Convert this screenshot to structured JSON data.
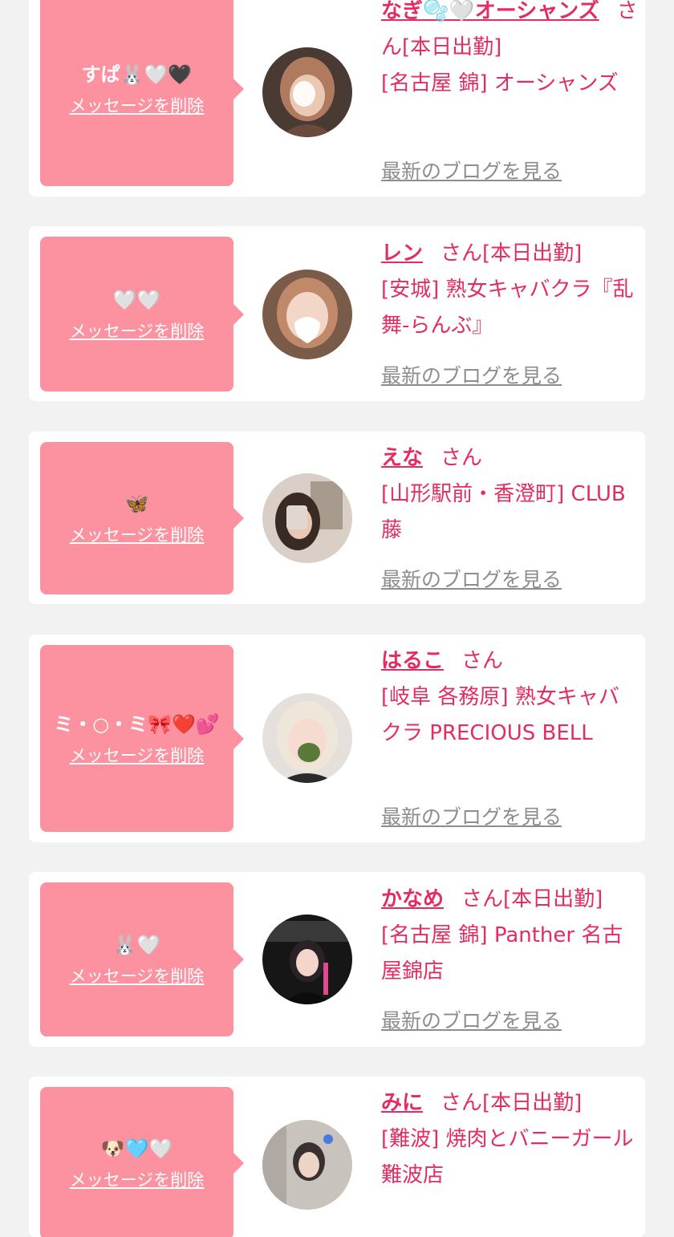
{
  "delete_label": "メッセージを削除",
  "blog_label": "最新のブログを見る",
  "colors": {
    "accent": "#e32d62",
    "bubble": "#fc91a0",
    "muted": "#8d8d8d",
    "background": "#f2f2f2"
  },
  "entries": [
    {
      "message": "すぱ🐰🤍🖤",
      "name": "なぎ🫧🤍オーシャンズ",
      "honorific": "さん",
      "status": "[本日出勤]",
      "shop": "[名古屋 錦] オーシャンズ",
      "avatar_icon": "avatar-photo"
    },
    {
      "message": "🤍🤍",
      "name": "レン",
      "honorific": "さん",
      "status": "[本日出勤]",
      "shop": "[安城] 熟女キャバクラ『乱舞-らんぶ』",
      "avatar_icon": "avatar-photo"
    },
    {
      "message": "🦋",
      "name": "えな",
      "honorific": "さん",
      "status": "",
      "shop": "[山形駅前・香澄町] CLUB 藤",
      "avatar_icon": "avatar-photo"
    },
    {
      "message": "ミ・○・ミ🎀❤️💕",
      "name": "はるこ",
      "honorific": "さん",
      "status": "",
      "shop": "[岐阜 各務原] 熟女キャバクラ PRECIOUS BELL",
      "avatar_icon": "avatar-photo"
    },
    {
      "message": "🐰🤍",
      "name": "かなめ",
      "honorific": "さん",
      "status": "[本日出勤]",
      "shop": "[名古屋 錦] Panther 名古屋錦店",
      "avatar_icon": "avatar-photo"
    },
    {
      "message": "🐶🩵🤍",
      "name": "みに",
      "honorific": "さん",
      "status": "[本日出勤]",
      "shop": "[難波] 焼肉とバニーガール難波店",
      "avatar_icon": "avatar-photo"
    }
  ]
}
